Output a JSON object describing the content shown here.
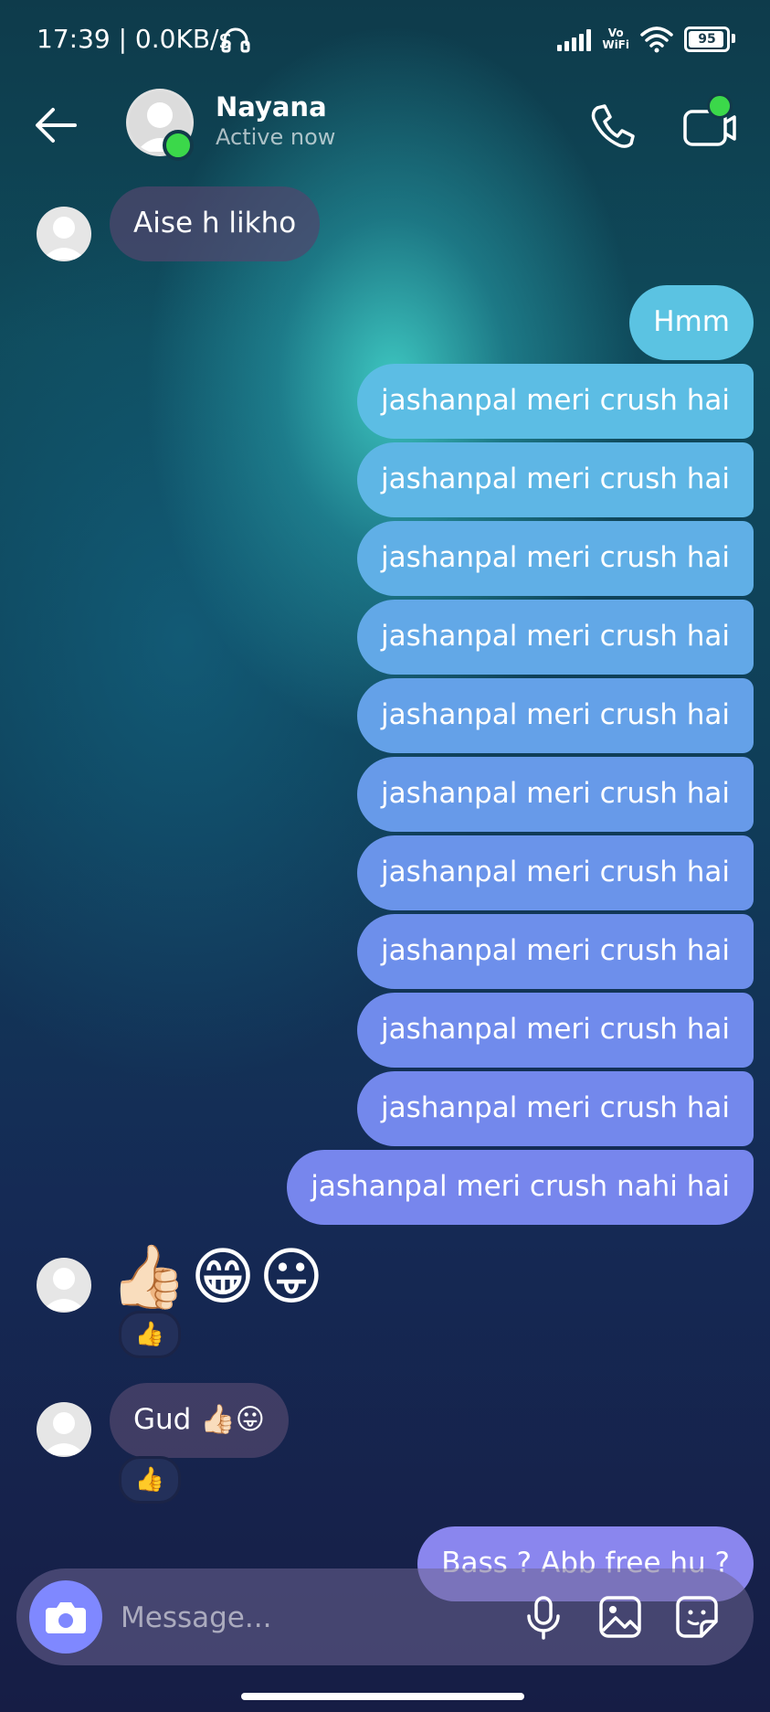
{
  "status_bar": {
    "time": "17:39 | 0.0KB/s",
    "network": "Vo\nWiFi",
    "battery": "95"
  },
  "header": {
    "contact_name": "Nayana",
    "contact_status": "Active now"
  },
  "messages": {
    "m1": "Aise h likho",
    "m2": "Hmm",
    "m3": "jashanpal meri crush hai",
    "m4": "jashanpal meri crush hai",
    "m5": "jashanpal meri crush hai",
    "m6": "jashanpal meri crush hai",
    "m7": "jashanpal meri crush hai",
    "m8": "jashanpal meri crush hai",
    "m9": "jashanpal meri crush hai",
    "m10": "jashanpal meri crush hai",
    "m11": "jashanpal meri crush hai",
    "m12": "jashanpal meri crush hai",
    "m13": "jashanpal meri crush nahi hai",
    "m14": "👍🏻😁😛",
    "m14_reaction": "👍",
    "m15": "Gud 👍🏻😛",
    "m15_reaction": "👍",
    "m16": "Bass ? Abb free hu ?"
  },
  "composer": {
    "placeholder": "Message..."
  },
  "colors": {
    "outgoing_top": "#5bc3e2",
    "outgoing_bottom": "#8a86ee",
    "online": "#3bd84a",
    "camera_button": "#7f88ff"
  }
}
